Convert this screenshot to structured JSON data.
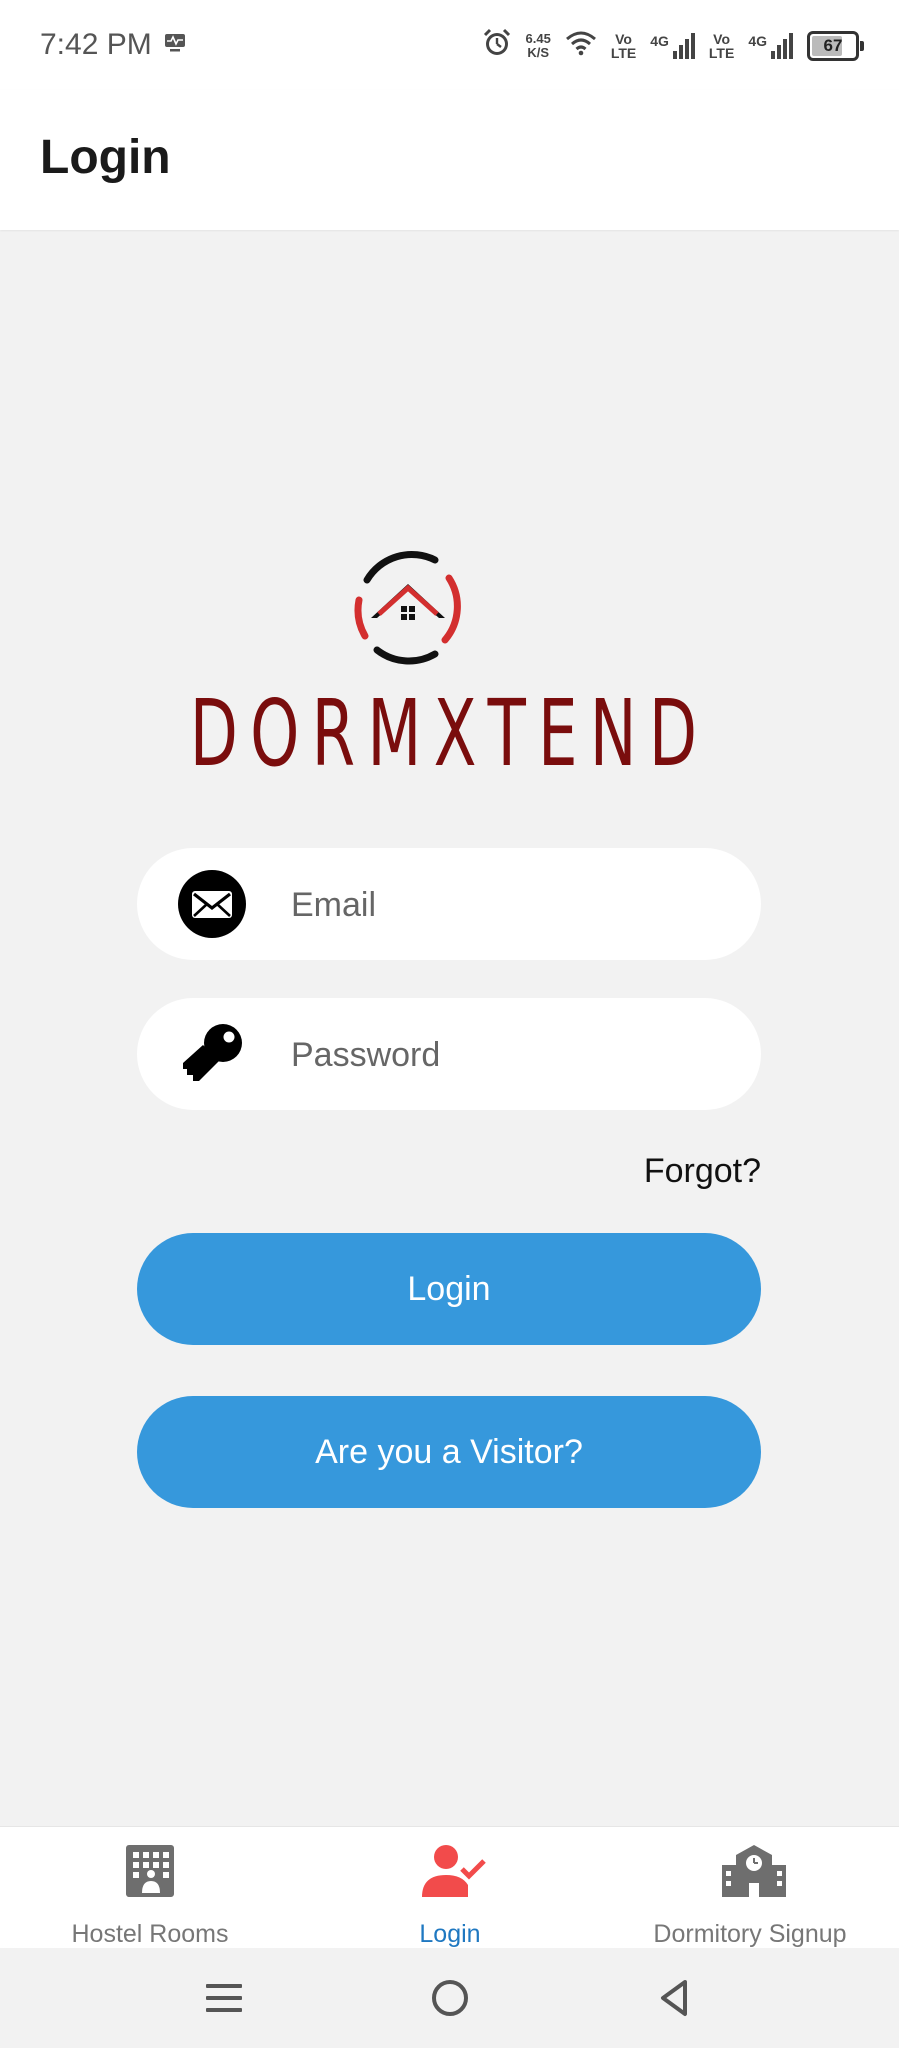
{
  "status_bar": {
    "time": "7:42 PM",
    "net_speed_value": "6.45",
    "net_speed_unit": "K/S",
    "volte1_top": "Vo",
    "volte1_bottom": "LTE",
    "sig1_label": "4G",
    "volte2_top": "Vo",
    "volte2_bottom": "LTE",
    "sig2_label": "4G",
    "battery": "67",
    "icons": [
      "monitor-icon",
      "alarm-icon",
      "wifi-icon",
      "signal-icon",
      "battery-icon"
    ]
  },
  "header": {
    "title": "Login"
  },
  "brand": {
    "name": "DORMXTEND",
    "color": "#7a0d0d",
    "accent": "#d32f2f"
  },
  "form": {
    "email_placeholder": "Email",
    "password_placeholder": "Password",
    "forgot_label": "Forgot?",
    "login_label": "Login",
    "visitor_label": "Are you a Visitor?",
    "button_color": "#3698dc"
  },
  "bottom_nav": {
    "items": [
      {
        "label": "Hostel Rooms",
        "icon": "hotel-icon",
        "active": false
      },
      {
        "label": "Login",
        "icon": "user-check-icon",
        "active": true
      },
      {
        "label": "Dormitory Signup",
        "icon": "school-icon",
        "active": false
      }
    ],
    "active_color": "#1f78c1",
    "active_icon_color": "#f24b4b",
    "inactive_color": "#777777"
  },
  "system_nav": {
    "icons": [
      "menu-icon",
      "home-circle-icon",
      "back-triangle-icon"
    ]
  }
}
